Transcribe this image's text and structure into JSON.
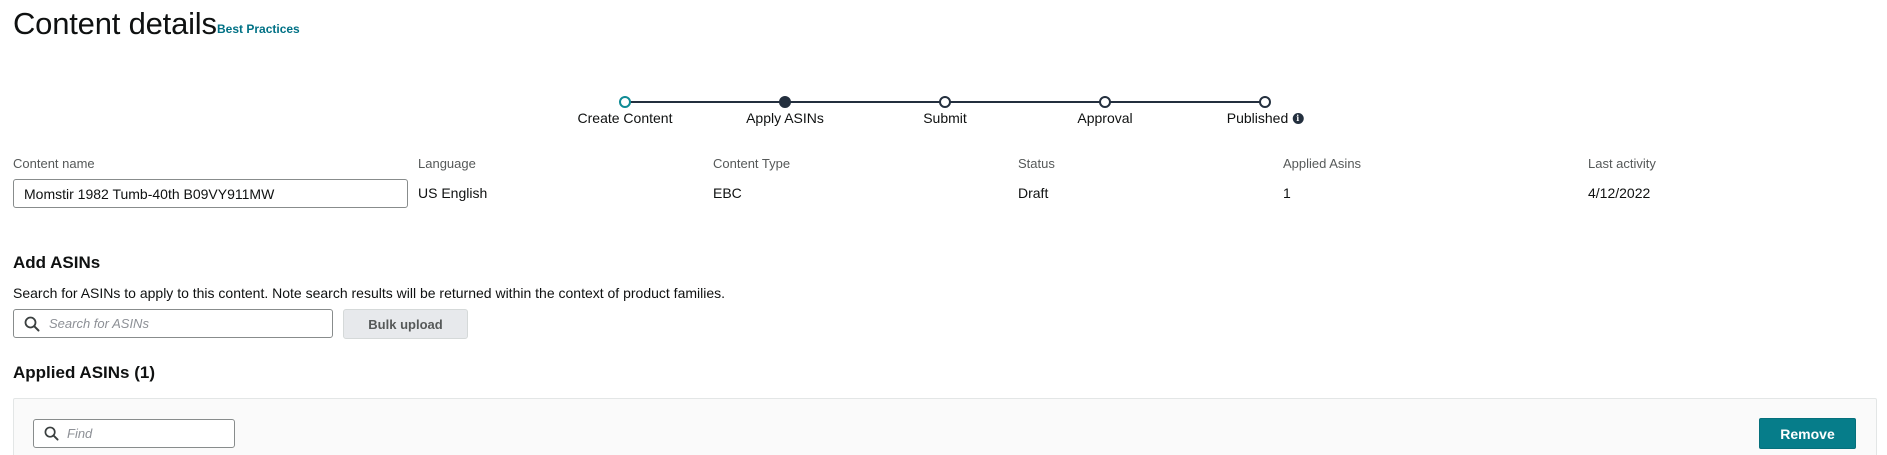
{
  "header": {
    "title": "Content details",
    "best_practices_link": "Best Practices"
  },
  "stepper": {
    "steps": [
      {
        "label": "Create Content",
        "state": "completed"
      },
      {
        "label": "Apply ASINs",
        "state": "current"
      },
      {
        "label": "Submit",
        "state": "pending"
      },
      {
        "label": "Approval",
        "state": "pending"
      },
      {
        "label": "Published",
        "state": "pending",
        "has_info_icon": true
      }
    ],
    "info_icon": "i"
  },
  "details": {
    "content_name_label": "Content name",
    "content_name_value": "Momstir 1982 Tumb-40th B09VY911MW",
    "language_label": "Language",
    "language_value": "US English",
    "content_type_label": "Content Type",
    "content_type_value": "EBC",
    "status_label": "Status",
    "status_value": "Draft",
    "applied_asins_label": "Applied Asins",
    "applied_asins_value": "1",
    "last_activity_label": "Last activity",
    "last_activity_value": "4/12/2022"
  },
  "add_asins": {
    "title": "Add ASINs",
    "description": "Search for ASINs to apply to this content. Note search results will be returned within the context of product families.",
    "search_placeholder": "Search for ASINs",
    "bulk_upload_label": "Bulk upload"
  },
  "applied_asins": {
    "title": "Applied ASINs (1)",
    "find_placeholder": "Find",
    "remove_label": "Remove"
  },
  "colors": {
    "accent": "#007185",
    "primary_button": "#067d8a",
    "stepper_line": "#232f3e",
    "stepper_start": "#0f8b95"
  }
}
